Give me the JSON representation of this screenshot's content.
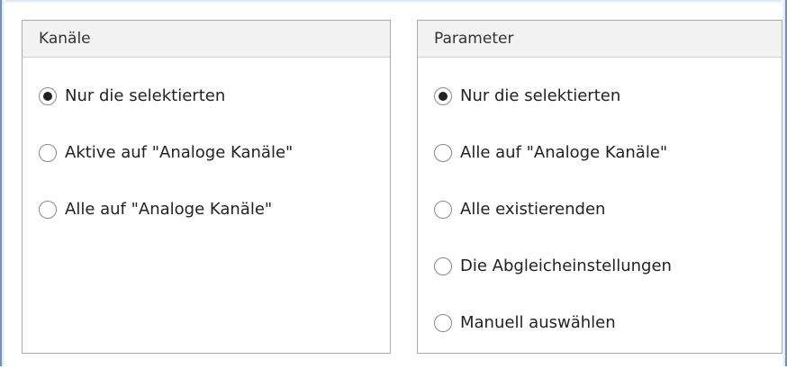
{
  "kanaele": {
    "title": "Kanäle",
    "options": [
      {
        "label": "Nur die selektierten",
        "checked": true
      },
      {
        "label": "Aktive auf \"Analoge Kanäle\"",
        "checked": false
      },
      {
        "label": "Alle auf \"Analoge Kanäle\"",
        "checked": false
      }
    ]
  },
  "parameter": {
    "title": "Parameter",
    "options": [
      {
        "label": "Nur die selektierten",
        "checked": true
      },
      {
        "label": "Alle auf \"Analoge Kanäle\"",
        "checked": false
      },
      {
        "label": "Alle existierenden",
        "checked": false
      },
      {
        "label": "Die Abgleicheinstellungen",
        "checked": false
      },
      {
        "label": "Manuell auswählen",
        "checked": false
      }
    ]
  }
}
